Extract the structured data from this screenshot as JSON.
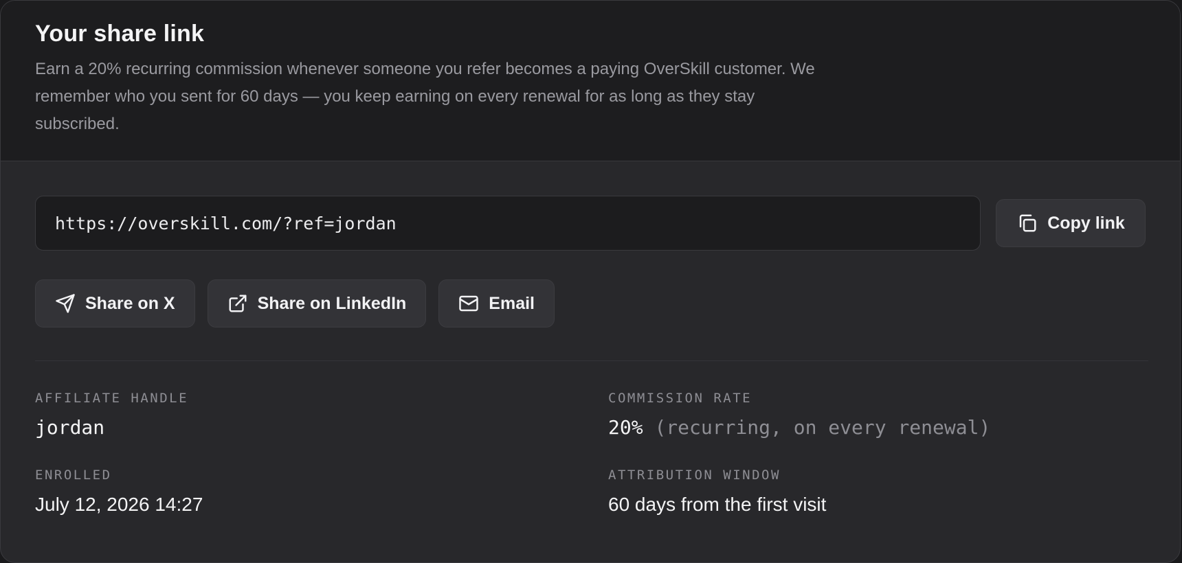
{
  "header": {
    "title": "Your share link",
    "description": "Earn a 20% recurring commission whenever someone you refer becomes a paying OverSkill customer. We remember who you sent for 60 days — you keep earning on every renewal for as long as they stay subscribed."
  },
  "link": {
    "url": "https://overskill.com/?ref=jordan",
    "copy_label": "Copy link",
    "copy_icon": "copy-icon"
  },
  "share": [
    {
      "label": "Share on X",
      "icon": "send-icon"
    },
    {
      "label": "Share on LinkedIn",
      "icon": "external-link-icon"
    },
    {
      "label": "Email",
      "icon": "mail-icon"
    }
  ],
  "meta": {
    "affiliate_handle": {
      "label": "AFFILIATE HANDLE",
      "value": "jordan"
    },
    "commission_rate": {
      "label": "COMMISSION RATE",
      "value": "20%",
      "note": "(recurring, on every renewal)"
    },
    "enrolled": {
      "label": "ENROLLED",
      "value": "July 12, 2026 14:27"
    },
    "attribution_window": {
      "label": "ATTRIBUTION WINDOW",
      "value": "60 days from the first visit"
    }
  },
  "colors": {
    "background": "#28282b",
    "header_background": "#1d1d1f",
    "button": "#333337",
    "text": "#f4f4f5",
    "muted_text": "#8e8e94"
  }
}
